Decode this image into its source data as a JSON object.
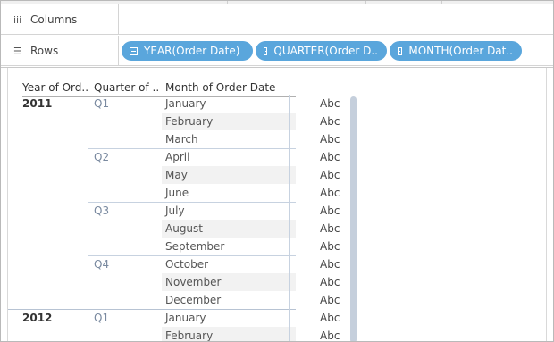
{
  "shelves": {
    "columns": {
      "label": "Columns",
      "icon": "columns-icon",
      "icon_glyph": "iii"
    },
    "rows": {
      "label": "Rows",
      "icon": "rows-icon",
      "icon_glyph": "☰",
      "pills": [
        {
          "label": "YEAR(Order Date)",
          "expand_state": "collapse"
        },
        {
          "label": "QUARTER(Order D..",
          "expand_state": "collapse"
        },
        {
          "label": "MONTH(Order Dat..",
          "expand_state": "expand"
        }
      ]
    }
  },
  "colors": {
    "pill": "#5aa6dc",
    "quarter_text": "#7a8aa0",
    "grid_line": "#c7d2e0"
  },
  "table": {
    "headers": [
      "Year of Ord..",
      "Quarter of ..",
      "Month of Order Date"
    ],
    "years": [
      {
        "year": "2011",
        "quarters": [
          {
            "quarter": "Q1",
            "months": [
              "January",
              "February",
              "March"
            ]
          },
          {
            "quarter": "Q2",
            "months": [
              "April",
              "May",
              "June"
            ]
          },
          {
            "quarter": "Q3",
            "months": [
              "July",
              "August",
              "September"
            ]
          },
          {
            "quarter": "Q4",
            "months": [
              "October",
              "November",
              "December"
            ]
          }
        ]
      },
      {
        "year": "2012",
        "quarters": [
          {
            "quarter": "Q1",
            "months": [
              "January",
              "February"
            ]
          }
        ]
      }
    ],
    "cell_text": "Abc"
  }
}
